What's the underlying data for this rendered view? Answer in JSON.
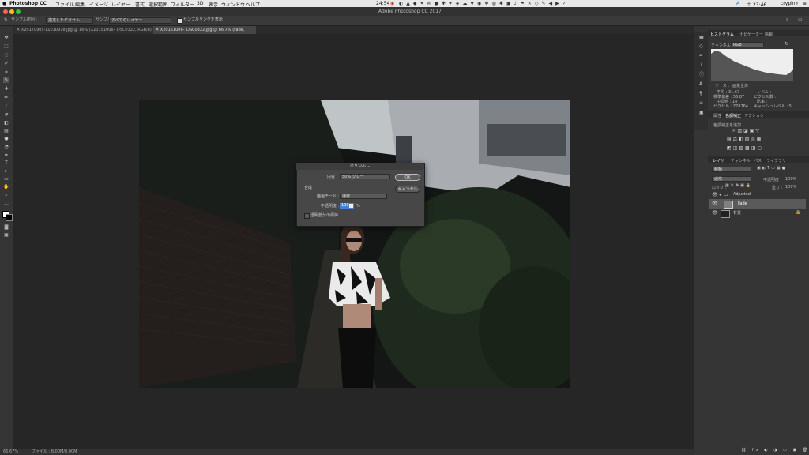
{
  "menubar": {
    "app_name": "Photoshop CC",
    "menus": [
      "ファイル",
      "編集",
      "イメージ",
      "レイヤー",
      "書式",
      "選択範囲",
      "フィルター",
      "3D",
      "表示",
      "ウィンドウ",
      "ヘルプ"
    ],
    "status_time_left": "24:54",
    "user": "crypin",
    "clock": "土 23:46"
  },
  "window": {
    "title": "Adobe Photoshop CC 2017"
  },
  "options": {
    "sample_size_label": "サンプル範囲 :",
    "sample_size_value": "指定したピクセル",
    "sample_label": "サンプル :",
    "sample_value": "すべてのレイヤー",
    "show_ring_label": "サンプルリングを表示"
  },
  "tabs": [
    {
      "label": "X20170905-L1010978.jpg @ 16% (X20151006-_DSC0322, RGB/8) *"
    },
    {
      "label": "X20151006-_DSC0322.jpg @ 66.7% (Fade, RGB/8) *"
    }
  ],
  "status": {
    "zoom": "66.67%",
    "doc": "ファイル : 8.00M/8.00M"
  },
  "panels": {
    "histogram_tabs": [
      "ヒストグラム",
      "ナビゲーター",
      "情報"
    ],
    "channel_label": "チャンネル :",
    "channel_value": "RGB",
    "source_label": "ソース :",
    "source_value": "画像全体",
    "stats_left": [
      "平均 : 31.67",
      "標準偏差 : 56.87",
      "中間値 : 14",
      "ピクセル : 778764"
    ],
    "stats_right": [
      "レベル :",
      "ピクセル数 :",
      "比率 :",
      "キャッシュレベル : 5"
    ],
    "adjust_tabs": [
      "属性",
      "色調補正",
      "アクション"
    ],
    "adjust_hint": "色調補正を追加",
    "layer_tabs": [
      "レイヤー",
      "チャンネル",
      "パス",
      "ライブラリ"
    ],
    "kind_label": "種類",
    "blend_value": "通常",
    "opacity_label": "不透明度 :",
    "opacity_value": "100%",
    "lock_label": "ロック :",
    "fill_label": "塗り :",
    "fill_value": "100%",
    "layers": [
      {
        "name": "Adjusted"
      },
      {
        "name": "Fade"
      },
      {
        "name": "背景"
      }
    ]
  },
  "dialog": {
    "title": "塗りつぶし",
    "contents_label": "内容 :",
    "contents_value": "50% グレー",
    "blend_section": "合成",
    "mode_label": "描画モード :",
    "mode_value": "通常",
    "opacity_label": "不透明度 :",
    "opacity_value": "100",
    "opacity_unit": "%",
    "preserve_label": "透明部分の保持",
    "ok_label": "OK",
    "cancel_label": "キャンセル"
  }
}
